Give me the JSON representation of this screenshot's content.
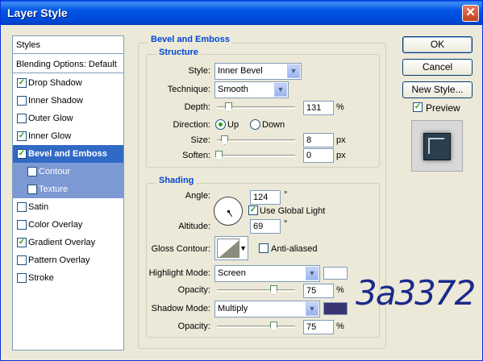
{
  "window": {
    "title": "Layer Style",
    "close_glyph": "✕"
  },
  "styles_list": {
    "header": "Styles",
    "blending": "Blending Options: Default",
    "items": [
      {
        "label": "Drop Shadow",
        "checked": true
      },
      {
        "label": "Inner Shadow",
        "checked": false
      },
      {
        "label": "Outer Glow",
        "checked": false
      },
      {
        "label": "Inner Glow",
        "checked": true
      },
      {
        "label": "Bevel and Emboss",
        "checked": true,
        "selected": true
      },
      {
        "label": "Contour",
        "checked": false,
        "sub": true
      },
      {
        "label": "Texture",
        "checked": false,
        "sub": true
      },
      {
        "label": "Satin",
        "checked": false
      },
      {
        "label": "Color Overlay",
        "checked": false
      },
      {
        "label": "Gradient Overlay",
        "checked": true
      },
      {
        "label": "Pattern Overlay",
        "checked": false
      },
      {
        "label": "Stroke",
        "checked": false
      }
    ]
  },
  "bevel": {
    "title": "Bevel and Emboss",
    "structure": {
      "title": "Structure",
      "style_label": "Style:",
      "style_value": "Inner Bevel",
      "technique_label": "Technique:",
      "technique_value": "Smooth",
      "depth_label": "Depth:",
      "depth_value": "131",
      "depth_unit": "%",
      "depth_fraction": 0.13,
      "direction_label": "Direction:",
      "direction_up": "Up",
      "direction_down": "Down",
      "direction_selected": "Up",
      "size_label": "Size:",
      "size_value": "8",
      "size_unit": "px",
      "size_fraction": 0.08,
      "soften_label": "Soften:",
      "soften_value": "0",
      "soften_unit": "px",
      "soften_fraction": 0.0
    },
    "shading": {
      "title": "Shading",
      "angle_label": "Angle:",
      "angle_value": "124",
      "angle_unit": "°",
      "global_light_label": "Use Global Light",
      "global_light_checked": true,
      "altitude_label": "Altitude:",
      "altitude_value": "69",
      "altitude_unit": "°",
      "gloss_label": "Gloss Contour:",
      "anti_aliased_label": "Anti-aliased",
      "anti_aliased_checked": false,
      "highlight_label": "Highlight Mode:",
      "highlight_value": "Screen",
      "highlight_color": "#ffffff",
      "highlight_opacity_label": "Opacity:",
      "highlight_opacity_value": "75",
      "highlight_opacity_unit": "%",
      "highlight_opacity_fraction": 0.75,
      "shadow_label": "Shadow Mode:",
      "shadow_value": "Multiply",
      "shadow_color": "#3a3372",
      "shadow_opacity_label": "Opacity:",
      "shadow_opacity_value": "75",
      "shadow_opacity_unit": "%",
      "shadow_opacity_fraction": 0.75
    }
  },
  "buttons": {
    "ok": "OK",
    "cancel": "Cancel",
    "new_style": "New Style...",
    "preview_label": "Preview",
    "preview_checked": true
  },
  "annotation": {
    "handwritten_text": "3a3372"
  }
}
